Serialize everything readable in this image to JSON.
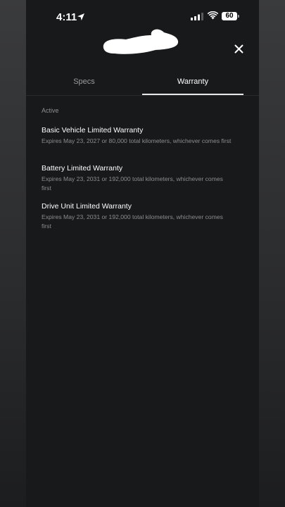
{
  "status_bar": {
    "time": "4:11",
    "battery": "60"
  },
  "tabs": [
    {
      "label": "Specs",
      "active": false
    },
    {
      "label": "Warranty",
      "active": true
    }
  ],
  "section_label": "Active",
  "warranties": [
    {
      "title": "Basic Vehicle Limited Warranty",
      "description": "Expires May 23, 2027 or 80,000 total kilometers, whichever comes first"
    },
    {
      "title": "Battery Limited Warranty",
      "description": "Expires May 23, 2031 or 192,000 total kilometers, whichever comes first"
    },
    {
      "title": "Drive Unit Limited Warranty",
      "description": "Expires May 23, 2031 or 192,000 total kilometers, whichever comes first"
    }
  ]
}
